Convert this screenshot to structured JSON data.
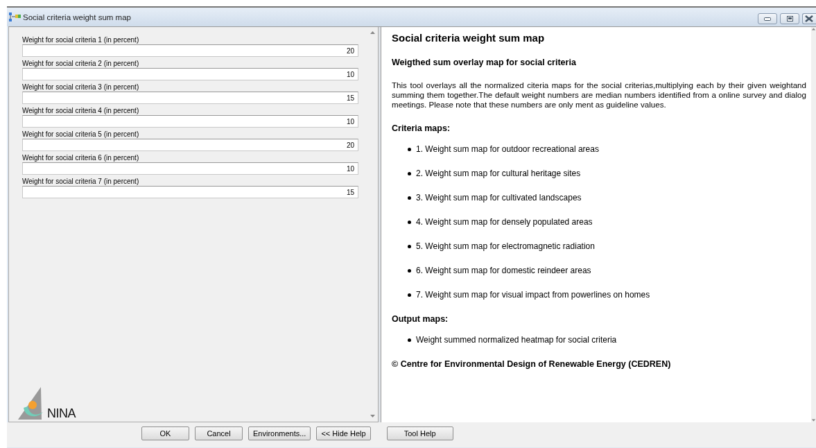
{
  "window": {
    "title": "Social criteria weight sum map"
  },
  "parameters": [
    {
      "label": "Weight for social criteria 1 (in percent)",
      "value": "20"
    },
    {
      "label": "Weight for social criteria 2 (in percent)",
      "value": "10"
    },
    {
      "label": "Weight for social criteria 3 (in percent)",
      "value": "15"
    },
    {
      "label": "Weight for social criteria 4 (in percent)",
      "value": "10"
    },
    {
      "label": "Weight for social criteria 5 (in percent)",
      "value": "20"
    },
    {
      "label": "Weight for social criteria 6 (in percent)",
      "value": "10"
    },
    {
      "label": "Weight for social criteria 7 (in percent)",
      "value": "15"
    }
  ],
  "logo": {
    "text": "NINA"
  },
  "help": {
    "title": "Social criteria weight sum map",
    "subtitle": "Weigthed sum overlay map for social criteria",
    "description": "This tool overlays all the normalized citeria maps for the social criterias,multiplying each by their given weightand summing them together.The default weight numbers are median numbers identified from a online survey and dialog meetings. Please note that these numbers are only ment as guideline values.",
    "sections": [
      {
        "heading": "Criteria maps:",
        "items": [
          "1. Weight sum map for outdoor recreational areas",
          "2. Weight sum map for cultural heritage sites",
          "3. Weight sum map for cultivated landscapes",
          "4. Weight sum map for densely populated areas",
          "5. Weight sum map for electromagnetic radiation",
          "6. Weight sum map for domestic reindeer areas",
          "7. Weight sum map for visual impact from powerlines on homes"
        ]
      },
      {
        "heading": "Output maps:",
        "items": [
          "Weight summed normalized heatmap for social criteria"
        ]
      }
    ],
    "footer": "© Centre for Environmental Design of Renewable Energy (CEDREN)"
  },
  "buttons": [
    "OK",
    "Cancel",
    "Environments...",
    "<< Hide Help",
    "Tool Help"
  ]
}
